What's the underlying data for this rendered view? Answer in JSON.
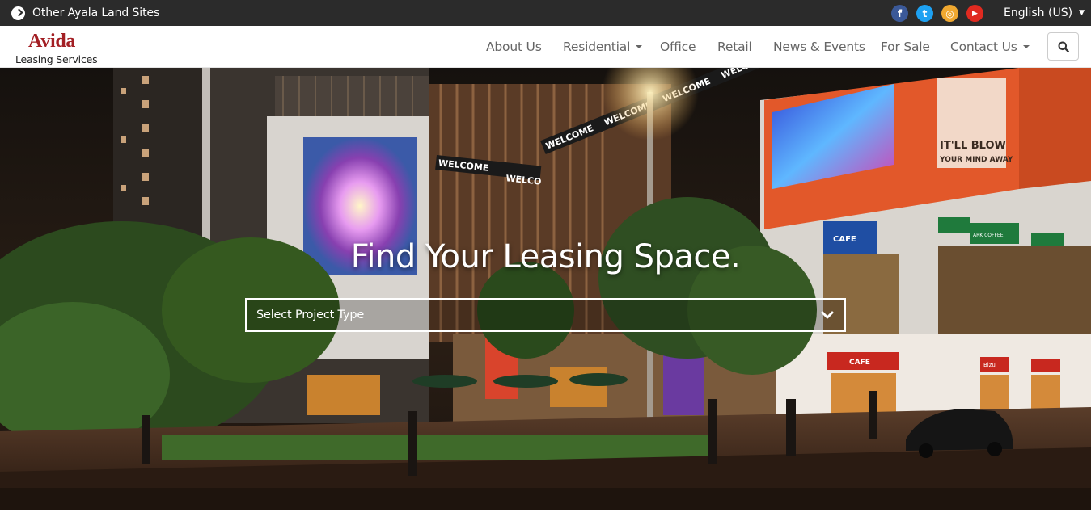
{
  "topbar": {
    "sites_label": "Other Ayala Land Sites",
    "social": [
      {
        "name": "facebook",
        "glyph": "f",
        "color": "#3b5998"
      },
      {
        "name": "twitter",
        "glyph": "t",
        "color": "#1da1f2"
      },
      {
        "name": "instagram",
        "glyph": "◎",
        "color": "#f0a830"
      },
      {
        "name": "youtube",
        "glyph": "▶",
        "color": "#e02a20"
      }
    ],
    "language": "English (US)",
    "language_caret": "▼"
  },
  "nav": {
    "logo_brand": "Avida",
    "logo_sub": "Leasing Services",
    "menu": [
      {
        "label": "About Us"
      },
      {
        "label": "Residential"
      },
      {
        "label": "Office"
      },
      {
        "label": "Retail"
      },
      {
        "label": "News & Events"
      },
      {
        "label": "For Sale"
      },
      {
        "label": "Contact Us"
      }
    ]
  },
  "hero": {
    "title": "Find Your Leasing Space.",
    "select_value": "Select Project Type"
  },
  "signage": {
    "welcome": "WELCOME",
    "welcome_cut": "WELCO",
    "cafe": "CAFE",
    "coffee": "ARK COFFEE",
    "billboard": "IT'LL BLOW",
    "billboard2": "YOUR MIND AWAY",
    "store": "Bizu"
  }
}
